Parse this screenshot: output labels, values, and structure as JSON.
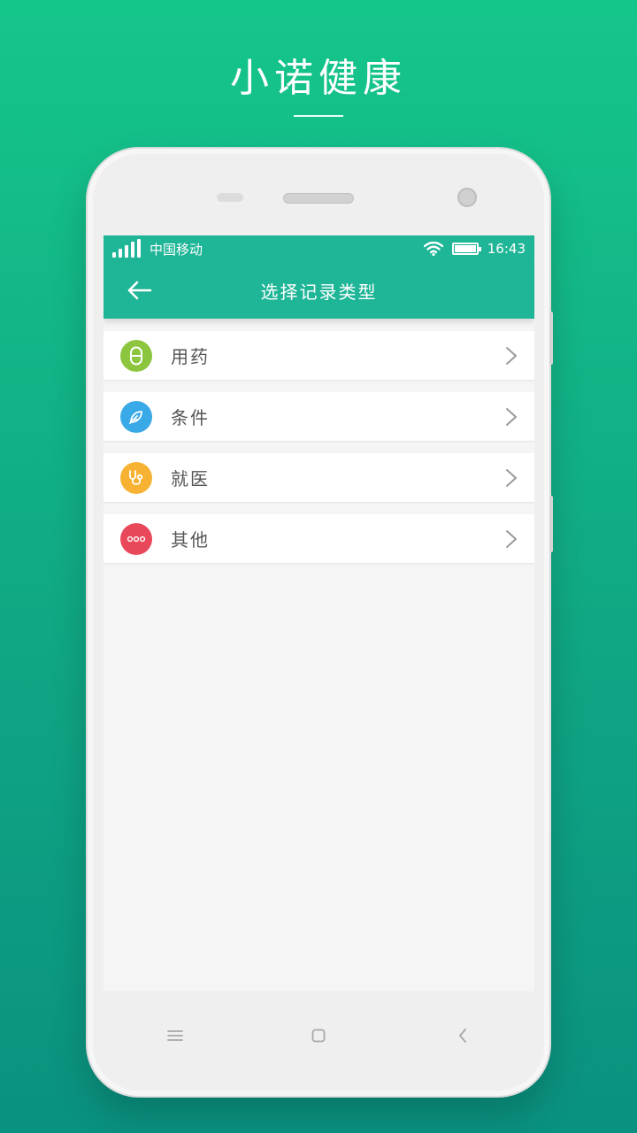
{
  "hero": {
    "title": "小诺健康"
  },
  "status": {
    "carrier": "中国移动",
    "time": "16:43"
  },
  "appbar": {
    "title": "选择记录类型"
  },
  "items": [
    {
      "label": "用药",
      "icon": "pill-icon",
      "color": "#8cc63f"
    },
    {
      "label": "条件",
      "icon": "feather-icon",
      "color": "#3aa9e8"
    },
    {
      "label": "就医",
      "icon": "stethoscope-icon",
      "color": "#f7b233"
    },
    {
      "label": "其他",
      "icon": "more-icon",
      "color": "#e9485a"
    }
  ],
  "colors": {
    "accent": "#1fb597",
    "background_top": "#15c68b",
    "background_bottom": "#0a9180"
  }
}
